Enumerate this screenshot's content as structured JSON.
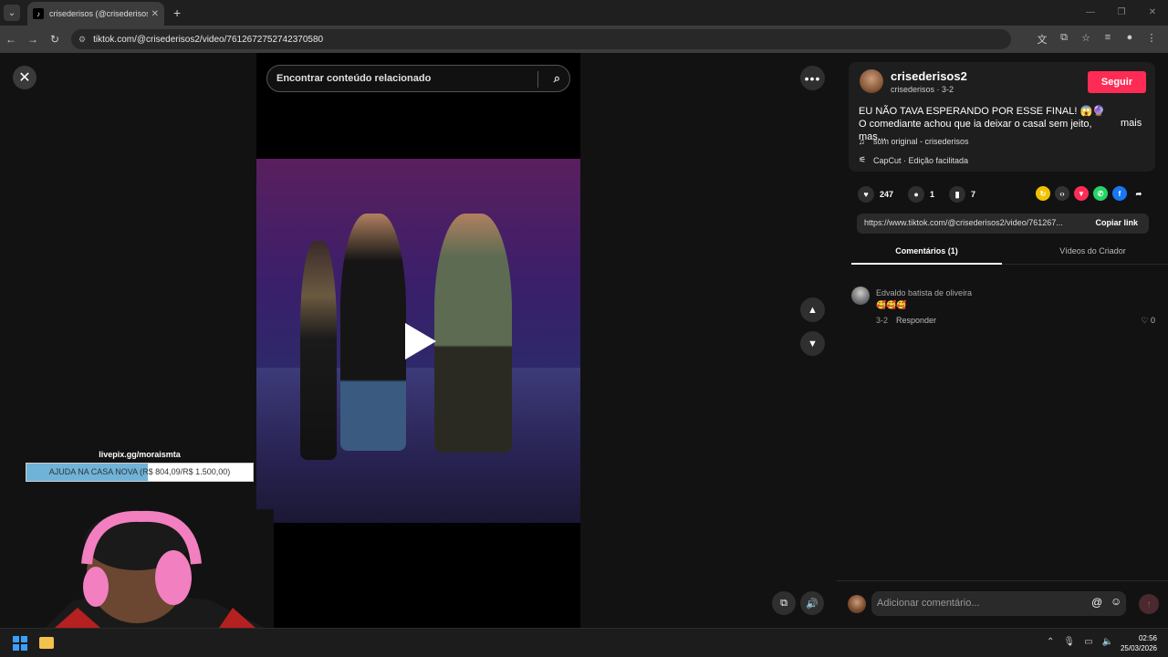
{
  "browser": {
    "tab_title": "crisederisos (@crisederisos2) | T",
    "url": "tiktok.com/@crisederisos2/video/7612672752742370580"
  },
  "search": {
    "placeholder": "Encontrar conteúdo relacionado"
  },
  "overlay": {
    "livepix_label": "livepix.gg/moraismta",
    "goal_text": "AJUDA NA CASA NOVA (R$ 804,09/R$ 1.500,00)",
    "goal_progress": 0.536
  },
  "author": {
    "name": "crisederisos2",
    "meta": "crisederisos · 3-2",
    "follow_label": "Seguir"
  },
  "post": {
    "description": "EU NÃO TAVA ESPERANDO POR ESSE FINAL! 😱🔮 O comediante achou que ia deixar o casal sem jeito, mas...",
    "more_label": "mais",
    "music": "som original - crisederisos",
    "capcut": "CapCut · Edição facilitada"
  },
  "stats": {
    "likes": "247",
    "comments": "1",
    "saves": "7"
  },
  "share": {
    "link": "https://www.tiktok.com/@crisederisos2/video/761267...",
    "copy_label": "Copiar link"
  },
  "tabs": {
    "comments": "Comentários (1)",
    "creator_videos": "Vídeos do Criador"
  },
  "comment": {
    "author": "Edvaldo batista de oliveira",
    "text": "🥰🥰🥰",
    "date": "3-2",
    "reply_label": "Responder",
    "likes": "0"
  },
  "composer": {
    "placeholder": "Adicionar comentário..."
  },
  "clock": {
    "time": "02:56",
    "date": "25/03/2026"
  },
  "colors": {
    "accent": "#fe2c55",
    "background": "#121212"
  }
}
